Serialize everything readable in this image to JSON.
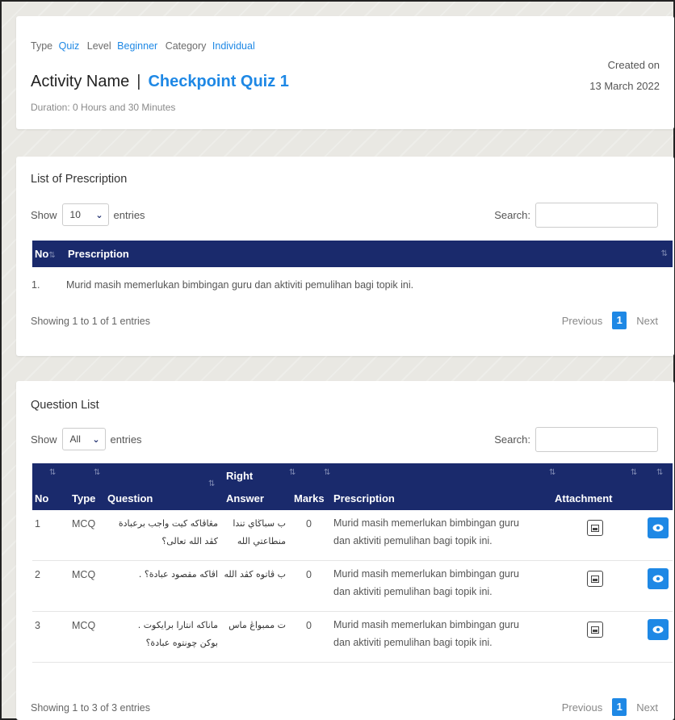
{
  "activity": {
    "type_label": "Type",
    "type_value": "Quiz",
    "level_label": "Level",
    "level_value": "Beginner",
    "category_label": "Category",
    "category_value": "Individual",
    "name_label": "Activity Name",
    "separator": "|",
    "name_value": "Checkpoint Quiz 1",
    "duration": "Duration: 0 Hours and 30 Minutes",
    "created_label": "Created on",
    "created_date": "13 March 2022"
  },
  "prescription_list": {
    "title": "List of Prescription",
    "show_label": "Show",
    "entries_value": "10",
    "entries_label": "entries",
    "search_label": "Search:",
    "search_value": "",
    "columns": {
      "no": "No",
      "prescription": "Prescription"
    },
    "rows": [
      {
        "no": "1.",
        "prescription": "Murid masih memerlukan bimbingan guru dan aktiviti pemulihan bagi topik ini."
      }
    ],
    "info": "Showing 1 to 1 of 1 entries",
    "pagination": {
      "previous": "Previous",
      "current": "1",
      "next": "Next"
    }
  },
  "question_list": {
    "title": "Question List",
    "show_label": "Show",
    "entries_value": "All",
    "entries_label": "entries",
    "search_label": "Search:",
    "search_value": "",
    "columns": {
      "no": "No",
      "type": "Type",
      "question": "Question",
      "right_answer_1": "Right",
      "right_answer_2": "Answer",
      "marks": "Marks",
      "prescription": "Prescription",
      "attachment": "Attachment"
    },
    "rows": [
      {
        "no": "1",
        "type": "MCQ",
        "question_1": "مڠاڤاكه كيت واجب برعبادة",
        "question_2": "كڤد الله تعالى؟",
        "answer_1": "ب سباڬاي تندا",
        "answer_2": "منطاعتي الله",
        "marks": "0",
        "prescription_1": "Murid masih memerlukan bimbingan guru",
        "prescription_2": "dan aktiviti pemulihan bagi topik ini."
      },
      {
        "no": "2",
        "type": "MCQ",
        "question_1": "اڤاكه مقصود عبادة؟ .",
        "question_2": "",
        "answer_1": "ب ڤاتوه كڤد الله",
        "answer_2": "",
        "marks": "0",
        "prescription_1": "Murid masih memerlukan bimbingan guru",
        "prescription_2": "dan aktiviti pemulihan bagi topik ini."
      },
      {
        "no": "3",
        "type": "MCQ",
        "question_1": "ماناكه انتارا برايكوت .",
        "question_2": "بوكن چونتوه عبادة؟",
        "answer_1": "ت ممبواڠ ماس",
        "answer_2": "",
        "marks": "0",
        "prescription_1": "Murid masih memerlukan bimbingan guru",
        "prescription_2": "dan aktiviti pemulihan bagi topik ini."
      }
    ],
    "info": "Showing 1 to 3 of 3 entries",
    "pagination": {
      "previous": "Previous",
      "current": "1",
      "next": "Next"
    }
  },
  "colors": {
    "accent": "#1e88e5",
    "table_header": "#1a2a6c",
    "page_background": "#e9e8e3"
  },
  "icons": [
    "sort-icon",
    "chevron-down-icon",
    "image-icon",
    "eye-icon"
  ]
}
